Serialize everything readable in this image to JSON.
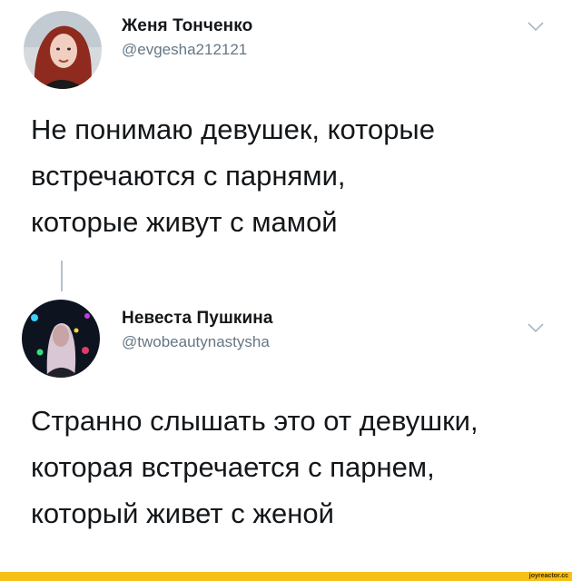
{
  "tweets": [
    {
      "author_name": "Женя Тонченко",
      "author_handle": "@evgesha212121",
      "avatar_icon": "profile-photo-red-hair-woman",
      "lines": [
        "Не понимаю девушек, которые",
        "встречаются с парнями,",
        "которые живут с мамой"
      ]
    },
    {
      "author_name": "Невеста Пушкина",
      "author_handle": "@twobeautynastysha",
      "avatar_icon": "profile-photo-woman-neon-club",
      "lines": [
        "Странно слышать это от девушки,",
        "которая встречается с парнем,",
        "который живет с женой"
      ]
    }
  ],
  "menu_icon": "chevron-down-icon",
  "colors": {
    "text": "#14171a",
    "secondary": "#657786",
    "thread_line": "#b8c1c8",
    "footer": "#f7c019"
  },
  "watermark": "joyreactor.cc"
}
